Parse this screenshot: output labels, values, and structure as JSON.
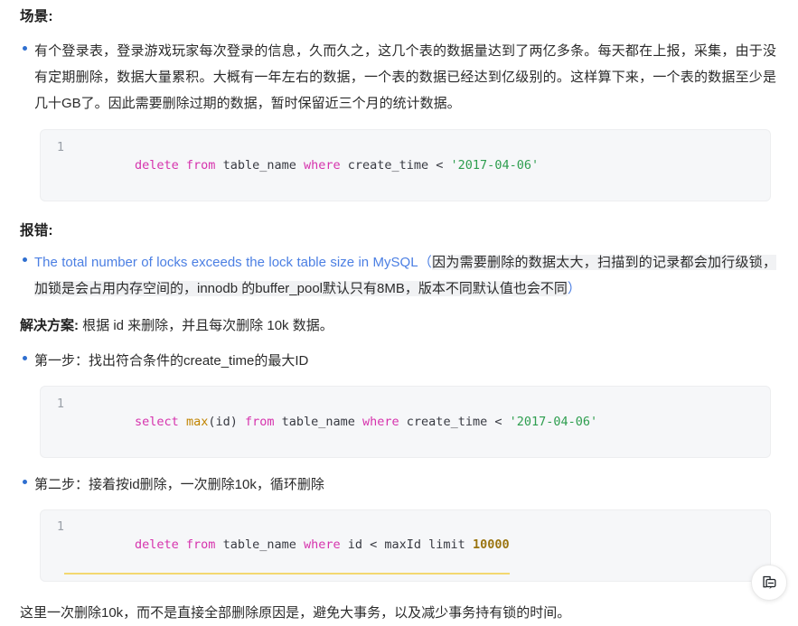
{
  "document": {
    "sections": {
      "scenario_heading": "场景:",
      "scenario_paragraph": "有个登录表，登录游戏玩家每次登录的信息，久而久之，这几个表的数据量达到了两亿多条。每天都在上报，采集，由于没有定期删除，数据大量累积。大概有一年左右的数据，一个表的数据已经达到亿级别的。这样算下来，一个表的数据至少是几十GB了。因此需要删除过期的数据，暂时保留近三个月的统计数据。",
      "error_heading": "报错:",
      "error_link_text": "The total number of locks exceeds the lock table size in MySQL",
      "error_note_open": "（",
      "error_note_text": "因为需要删除的数据太大，扫描到的记录都会加行级锁，加锁是会占用内存空间的，innodb 的buffer_pool默认只有8MB，版本不同默认值也会不同",
      "error_note_close": "）",
      "solution_label": "解决方案:",
      "solution_text": " 根据 id 来删除，并且每次删除 10k 数据。",
      "step_one": "第一步：找出符合条件的create_time的最大ID",
      "step_two": "第二步：接着按id删除，一次删除10k，循环删除",
      "closing_paragraph": "这里一次删除10k，而不是直接全部删除原因是，避免大事务，以及减少事务持有锁的时间。"
    },
    "code_blocks": [
      {
        "line_number": "1",
        "underlined": false,
        "tokens": [
          {
            "kind": "kw",
            "text": "delete from"
          },
          {
            "kind": "plain",
            "text": " table_name "
          },
          {
            "kind": "kw",
            "text": "where"
          },
          {
            "kind": "plain",
            "text": " create_time < "
          },
          {
            "kind": "str",
            "text": "'2017-04-06'"
          }
        ]
      },
      {
        "line_number": "1",
        "underlined": false,
        "tokens": [
          {
            "kind": "kw",
            "text": "select "
          },
          {
            "kind": "fn",
            "text": "max"
          },
          {
            "kind": "plain",
            "text": "(id) "
          },
          {
            "kind": "kw",
            "text": "from"
          },
          {
            "kind": "plain",
            "text": " table_name "
          },
          {
            "kind": "kw",
            "text": "where"
          },
          {
            "kind": "plain",
            "text": " create_time < "
          },
          {
            "kind": "str",
            "text": "'2017-04-06'"
          }
        ]
      },
      {
        "line_number": "1",
        "underlined": true,
        "tokens": [
          {
            "kind": "kw",
            "text": "delete from"
          },
          {
            "kind": "plain",
            "text": " table_name "
          },
          {
            "kind": "kw",
            "text": "where"
          },
          {
            "kind": "plain",
            "text": " id < maxId limit "
          },
          {
            "kind": "num",
            "text": "10000"
          }
        ]
      }
    ],
    "floating_button": {
      "icon": "note-comment-icon",
      "label": "批注"
    },
    "colors": {
      "link": "#4b7fe3",
      "bullet": "#2f6fd0",
      "code_background": "#f6f7f9",
      "keyword": "#d633ad",
      "function": "#c18401",
      "string": "#2e9e4f",
      "number": "#9a7410",
      "underline": "#f3d870",
      "highlight": "#f1f2f4",
      "text": "#2b2b2b"
    }
  }
}
